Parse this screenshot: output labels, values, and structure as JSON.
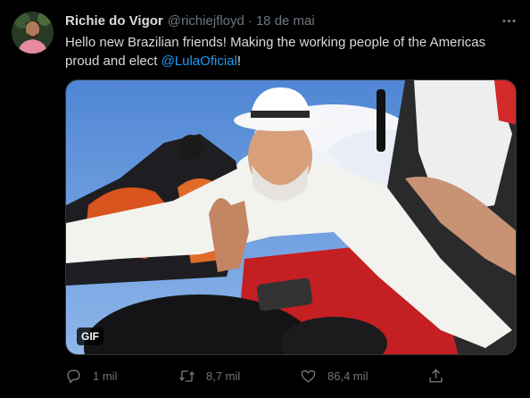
{
  "tweet": {
    "display_name": "Richie do Vigor",
    "handle": "@richiejfloyd",
    "separator": "·",
    "timestamp": "18 de mai",
    "text_part1": "Hello new Brazilian friends! Making the working people of the Americas proud and elect ",
    "mention": "@LulaOficial",
    "text_part2": "!",
    "media_badge": "GIF"
  },
  "actions": {
    "reply_count": "1 mil",
    "retweet_count": "8,7 mil",
    "like_count": "86,4 mil"
  },
  "icons": {
    "more": "more-horizontal-icon",
    "reply": "reply-icon",
    "retweet": "retweet-icon",
    "like": "heart-icon",
    "share": "share-icon"
  },
  "colors": {
    "background": "#000000",
    "text": "#d9d9d9",
    "muted": "#6e767d",
    "link": "#1d9bf0"
  }
}
